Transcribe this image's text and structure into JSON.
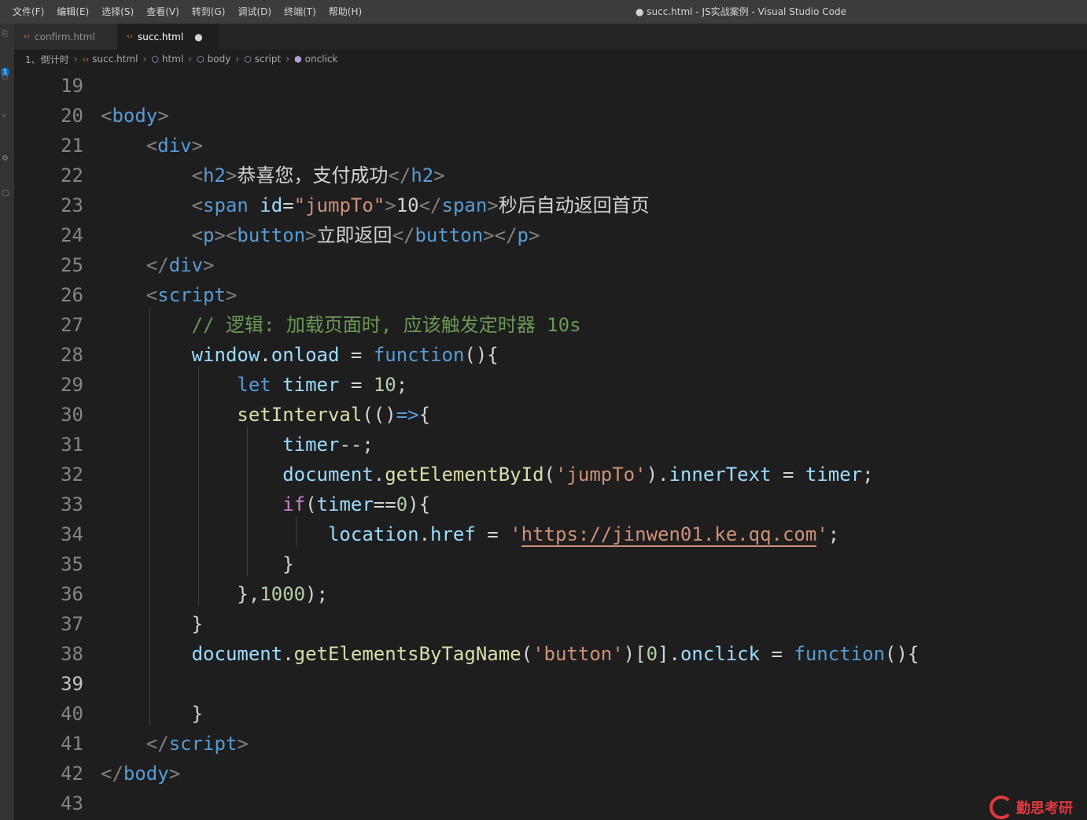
{
  "titlebar": {
    "menus": [
      "文件(F)",
      "编辑(E)",
      "选择(S)",
      "查看(V)",
      "转到(G)",
      "调试(D)",
      "终端(T)",
      "帮助(H)"
    ],
    "window_title": "● succ.html - JS实战案例 - Visual Studio Code"
  },
  "activity": {
    "badge": "1"
  },
  "tabs": [
    {
      "label": "confirm.html",
      "active": false
    },
    {
      "label": "succ.html",
      "active": true,
      "dirty": "●"
    }
  ],
  "breadcrumb": {
    "folder": "1、倒计时",
    "items": [
      "succ.html",
      "html",
      "body",
      "script",
      "onclick"
    ]
  },
  "editor": {
    "current_line": "39",
    "line_numbers": [
      "19",
      "20",
      "21",
      "22",
      "23",
      "24",
      "25",
      "26",
      "27",
      "28",
      "29",
      "30",
      "31",
      "32",
      "33",
      "34",
      "35",
      "36",
      "37",
      "38",
      "39",
      "40",
      "41",
      "42",
      "43"
    ],
    "code": {
      "l20": "body",
      "l21": "div",
      "l22_tag": "h2",
      "l22_text": "恭喜您，支付成功",
      "l23_tag": "span",
      "l23_attr": "id",
      "l23_val": "\"jumpTo\"",
      "l23_num": "10",
      "l23_text": "秒后自动返回首页",
      "l24_p": "p",
      "l24_button": "button",
      "l24_text": "立即返回",
      "l25": "div",
      "l26": "script",
      "l27_comment": "// 逻辑: 加载页面时, 应该触发定时器 10s",
      "l28_obj": "window",
      "l28_prop": "onload",
      "l28_kw": "function",
      "l29_kw": "let",
      "l29_var": "timer",
      "l29_num": "10",
      "l30_fn": "setInterval",
      "l31_var": "timer",
      "l32_obj": "document",
      "l32_fn": "getElementById",
      "l32_str": "'jumpTo'",
      "l32_prop": "innerText",
      "l32_var": "timer",
      "l33_kw": "if",
      "l33_var": "timer",
      "l33_num": "0",
      "l34_obj": "location",
      "l34_prop": "href",
      "l34_url": "https://jinwen01.ke.qq.com",
      "l36_num": "1000",
      "l38_obj": "document",
      "l38_fn": "getElementsByTagName",
      "l38_str": "'button'",
      "l38_idx": "0",
      "l38_prop": "onclick",
      "l38_kw": "function",
      "l41": "script",
      "l42": "body"
    }
  },
  "watermark": {
    "text": "勤思考研"
  },
  "colors": {
    "editor_bg": "#1e1e1e",
    "tag": "#569cd6",
    "string": "#ce9178",
    "keyword": "#569cd6",
    "comment": "#6a9955",
    "variable": "#9cdcfe",
    "function": "#dcdcaa",
    "number": "#b5cea8"
  }
}
